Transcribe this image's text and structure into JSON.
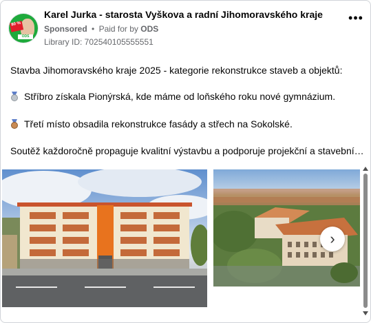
{
  "post": {
    "author": "Karel Jurka - starosta Vyškova a radní Jihomoravského kraje",
    "sponsored_label": "Sponsored",
    "separator": "•",
    "paid_for_label": "Paid for by",
    "payer": "ODS",
    "library_id": "Library ID: 702540105555551",
    "avatar_badge_top": "80 % ",
    "avatar_badge_bottom": "ODS",
    "more_icon": "more-options-icon",
    "text": {
      "line1": "Stavba Jihomoravského kraje 2025 - kategorie rekonstrukce staveb a objektů:",
      "line2": "Stříbro získala Pionýrská, kde máme od loňského roku nové gymnázium.",
      "line3": "Třetí místo obsadila rekonstrukce fasády a střech na Sokolské.",
      "line4": "Soutěž každoročně propaguje kvalitní výstavbu a podporuje projekční a stavební…"
    },
    "icons": {
      "line2": "silver-medal-icon",
      "line3": "bronze-medal-icon"
    }
  },
  "gallery": {
    "next_icon": "›"
  },
  "colors": {
    "text": "#050505",
    "secondary": "#65676b",
    "avatar": "#1faa3c",
    "building_accent": "#e8731e"
  }
}
